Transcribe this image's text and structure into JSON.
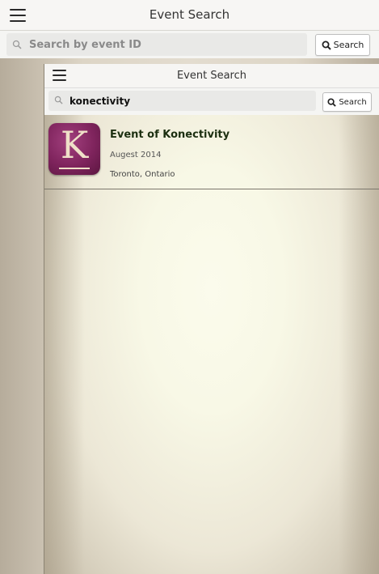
{
  "outer": {
    "header": {
      "title": "Event Search",
      "menu_icon": "hamburger-menu-icon"
    },
    "search": {
      "placeholder": "Search by event ID",
      "value": "",
      "button_label": "Search",
      "icon": "magnifier-icon"
    }
  },
  "inner": {
    "header": {
      "title": "Event Search",
      "menu_icon": "hamburger-menu-icon"
    },
    "search": {
      "placeholder": "",
      "value": "konectivity",
      "button_label": "Search",
      "icon": "magnifier-icon"
    },
    "results": [
      {
        "logo_letter": "K",
        "name": "Event of Konectivity",
        "date": "Augest 2014",
        "location": "Toronto, Ontario"
      }
    ]
  },
  "colors": {
    "logo_bg": "#7f245d",
    "logo_fg": "#efe0c8",
    "event_name": "#1c2f10"
  }
}
